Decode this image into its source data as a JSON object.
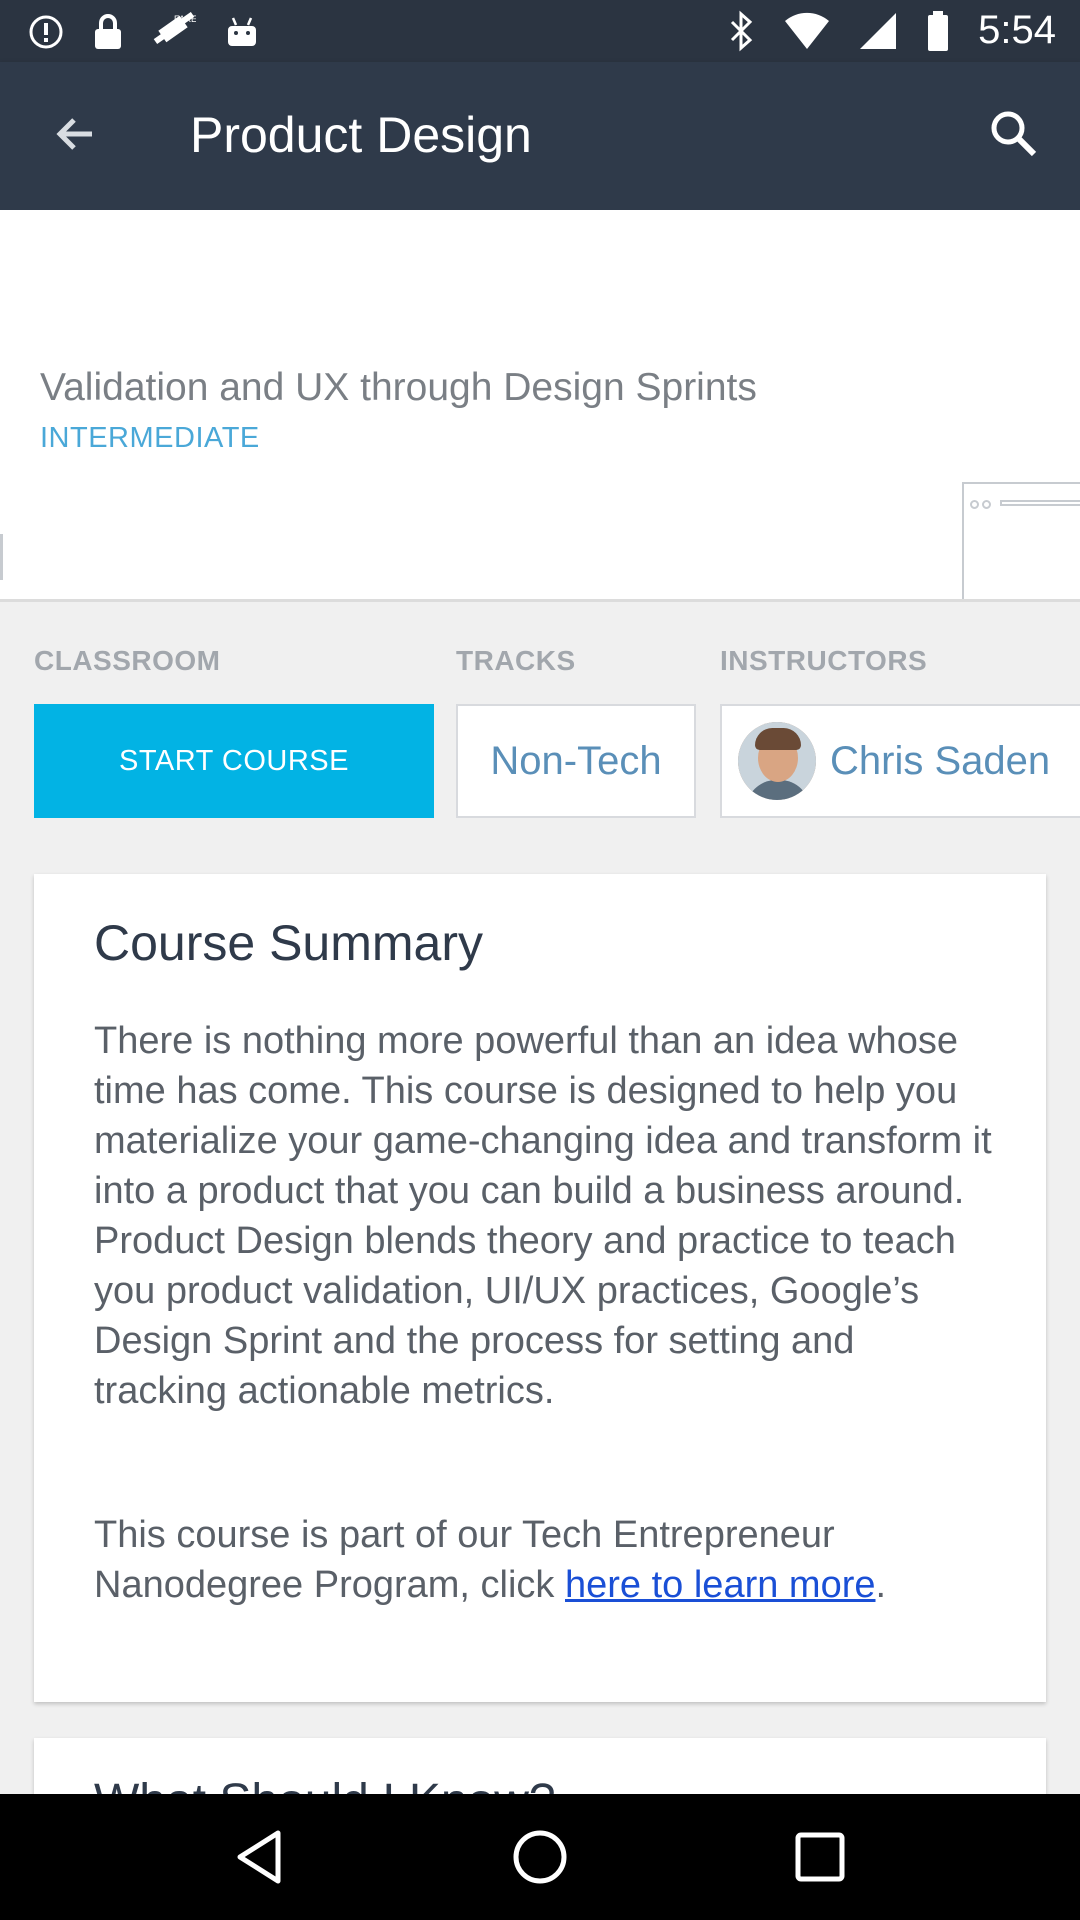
{
  "status_bar": {
    "time": "5:54",
    "icons": [
      "alert-icon",
      "lock-icon",
      "fake-gps-icon",
      "android-icon",
      "bluetooth-icon",
      "wifi-icon",
      "signal-icon",
      "battery-icon"
    ]
  },
  "app_bar": {
    "title": "Product Design",
    "back_icon": "back-arrow-icon",
    "search_icon": "search-icon"
  },
  "hero": {
    "course_title": "Validation and UX through Design Sprints",
    "level": "INTERMEDIATE"
  },
  "sections": {
    "classroom_label": "CLASSROOM",
    "tracks_label": "TRACKS",
    "instructors_label": "INSTRUCTORS",
    "start_button": "START COURSE",
    "track": "Non-Tech",
    "instructor": "Chris Saden"
  },
  "summary": {
    "heading": "Course Summary",
    "paragraph": "There is nothing more powerful than an idea whose time has come. This course is designed to help you materialize your game-changing idea and transform it into a product that you can build a business around. Product Design blends theory and practice to teach you product validation, UI/UX practices, Google’s Design Sprint and the process for setting and tracking actionable metrics.",
    "program_text": "This course is part of our Tech Entrepreneur Nanodegree Program, click ",
    "link_text": "here to learn more",
    "program_suffix": "."
  },
  "next_card": {
    "heading_peek": "What Should I Know?"
  },
  "colors": {
    "app_bar": "#2f3a4a",
    "accent": "#02b3e4",
    "level": "#4aa8d8",
    "link": "#1a4fd6"
  },
  "nav_bar": {
    "icons": [
      "back-triangle-icon",
      "home-circle-icon",
      "recents-square-icon"
    ]
  }
}
